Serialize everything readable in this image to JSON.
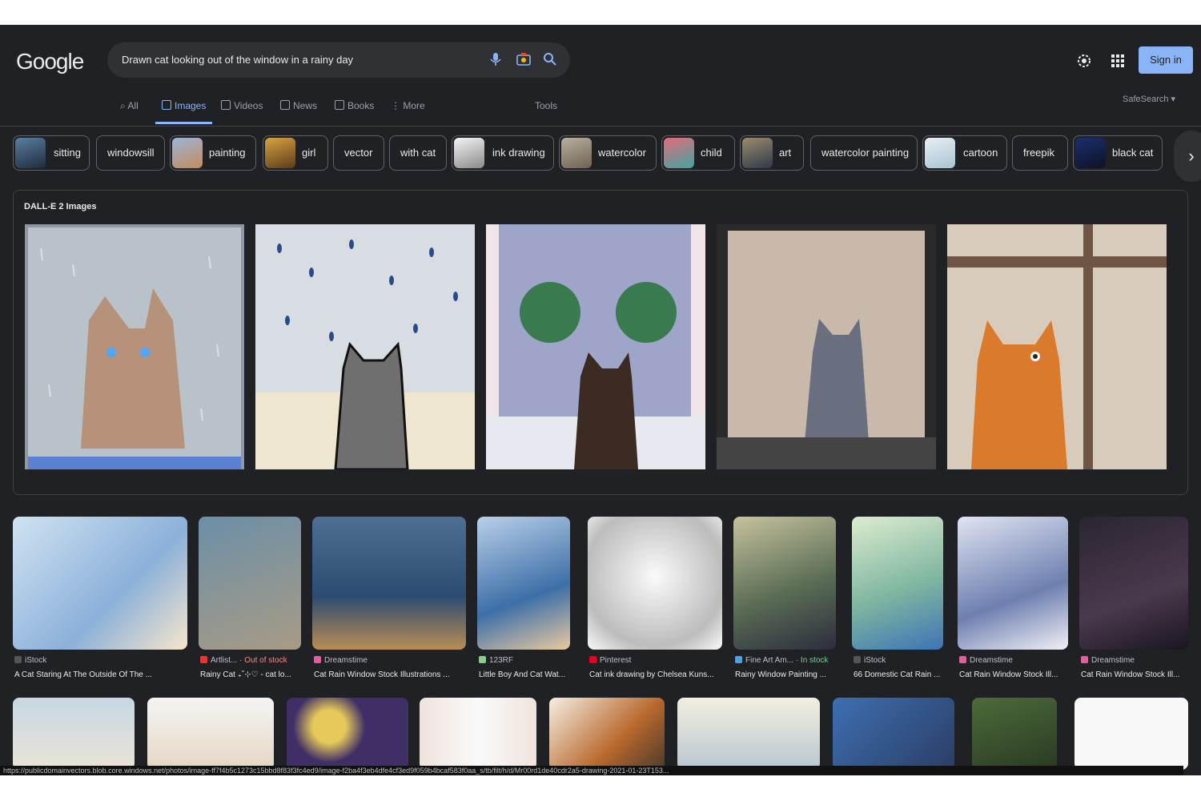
{
  "header": {
    "logo": "Google",
    "search_query": "Drawn cat looking out of the window in a rainy day",
    "signin_label": "Sign in",
    "safesearch_label": "SafeSearch ▾"
  },
  "tabs": [
    {
      "label": "All",
      "active": false
    },
    {
      "label": "Images",
      "active": true
    },
    {
      "label": "Videos",
      "active": false
    },
    {
      "label": "News",
      "active": false
    },
    {
      "label": "Books",
      "active": false
    },
    {
      "label": "More",
      "active": false
    }
  ],
  "tools_label": "Tools",
  "chips": [
    {
      "label": "sitting",
      "thumb": true
    },
    {
      "label": "windowsill",
      "thumb": false
    },
    {
      "label": "painting",
      "thumb": true
    },
    {
      "label": "girl",
      "thumb": true
    },
    {
      "label": "vector",
      "thumb": false
    },
    {
      "label": "with cat",
      "thumb": false
    },
    {
      "label": "ink drawing",
      "thumb": true
    },
    {
      "label": "watercolor",
      "thumb": true
    },
    {
      "label": "child",
      "thumb": true
    },
    {
      "label": "art",
      "thumb": true
    },
    {
      "label": "watercolor painting",
      "thumb": false
    },
    {
      "label": "cartoon",
      "thumb": true
    },
    {
      "label": "freepik",
      "thumb": false
    },
    {
      "label": "black cat",
      "thumb": true
    }
  ],
  "dalle": {
    "heading": "DALL-E 2 Images"
  },
  "results": [
    {
      "source": "iStock",
      "tag": "",
      "title": "A Cat Staring At The Outside Of The ..."
    },
    {
      "source": "Artlist...",
      "tag": "Out of stock",
      "title": "Rainy Cat ₊˚⊹♡ - cat lo..."
    },
    {
      "source": "Dreamstime",
      "tag": "",
      "title": "Cat Rain Window Stock Illustrations ..."
    },
    {
      "source": "123RF",
      "tag": "",
      "title": "Little Boy And Cat Wat..."
    },
    {
      "source": "Pinterest",
      "tag": "",
      "title": "Cat ink drawing by Chelsea Kuns..."
    },
    {
      "source": "Fine Art Am...",
      "tag": "In stock",
      "title": "Rainy Window Painting ..."
    },
    {
      "source": "iStock",
      "tag": "",
      "title": "66 Domestic Cat Rain ..."
    },
    {
      "source": "Dreamstime",
      "tag": "",
      "title": "Cat Rain Window Stock Ill..."
    },
    {
      "source": "Dreamstime",
      "tag": "",
      "title": "Cat Rain Window Stock Ill..."
    }
  ],
  "status_url": "https://publicdomainvectors.blob.core.windows.net/photos/image-ff7f4b5c1273c15bbd8f83f3fc4ed9/image-f2ba4f3eb4dfe4cf3ed9f059b4bcaf583f0aa_s/tb/filt/h/d/Mr00rd1de40cdr2a5-drawing-2021-01-23T153... "
}
